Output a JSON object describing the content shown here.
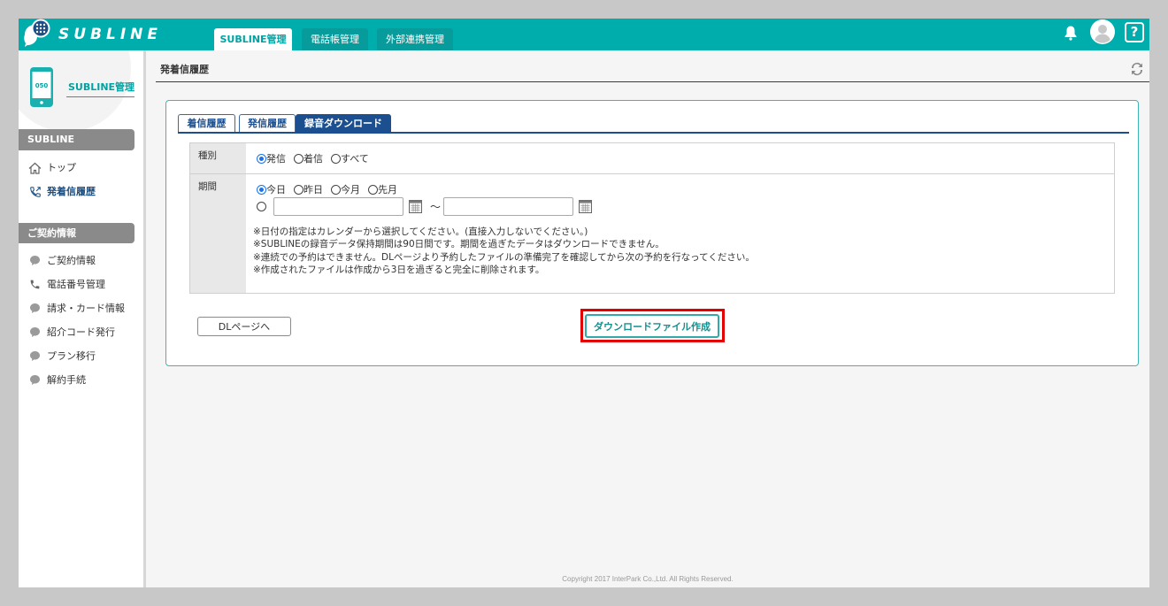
{
  "header": {
    "logo_text": "SUBLINE",
    "tabs": [
      {
        "label": "SUBLINE管理",
        "active": true
      },
      {
        "label": "電話帳管理",
        "active": false
      },
      {
        "label": "外部連携管理",
        "active": false
      }
    ],
    "help_glyph": "?",
    "icons": {
      "logo": "chat-keypad-icon",
      "notifications": "bell-icon",
      "account": "avatar-icon",
      "help": "help-icon"
    }
  },
  "sidebar": {
    "title": "SUBLINE管理",
    "device_number": "050",
    "sections": [
      {
        "header": "SUBLINE",
        "items": [
          {
            "label": "トップ",
            "icon": "home-icon",
            "active": false
          },
          {
            "label": "発着信履歴",
            "icon": "phone-calls-icon",
            "active": true
          }
        ]
      },
      {
        "header": "ご契約情報",
        "items": [
          {
            "label": "ご契約情報",
            "icon": "bubble-icon",
            "active": false
          },
          {
            "label": "電話番号管理",
            "icon": "phone-icon",
            "active": false
          },
          {
            "label": "請求・カード情報",
            "icon": "bubble-icon",
            "active": false
          },
          {
            "label": "紹介コード発行",
            "icon": "bubble-icon",
            "active": false
          },
          {
            "label": "プラン移行",
            "icon": "bubble-icon",
            "active": false
          },
          {
            "label": "解約手続",
            "icon": "bubble-icon",
            "active": false
          }
        ]
      }
    ]
  },
  "main": {
    "page_title": "発着信履歴",
    "refresh_icon": "refresh-icon",
    "tabs": [
      {
        "label": "着信履歴",
        "active": false
      },
      {
        "label": "発信履歴",
        "active": false
      },
      {
        "label": "録音ダウンロード",
        "active": true
      }
    ],
    "form": {
      "type": {
        "label": "種別",
        "options": [
          {
            "label": "発信",
            "checked": true
          },
          {
            "label": "着信",
            "checked": false
          },
          {
            "label": "すべて",
            "checked": false
          }
        ]
      },
      "period": {
        "label": "期間",
        "options": [
          {
            "label": "今日",
            "checked": true
          },
          {
            "label": "昨日",
            "checked": false
          },
          {
            "label": "今月",
            "checked": false
          },
          {
            "label": "先月",
            "checked": false
          }
        ],
        "custom_range": {
          "checked": false,
          "from": "",
          "to": "",
          "separator": "～",
          "icon": "calendar-icon"
        }
      },
      "notes": [
        "※日付の指定はカレンダーから選択してください。(直接入力しないでください。)",
        "※SUBLINEの録音データ保持期間は90日間です。期間を過ぎたデータはダウンロードできません。",
        "※連続での予約はできません。DLページより予約したファイルの準備完了を確認してから次の予約を行なってください。",
        "※作成されたファイルは作成から3日を過ぎると完全に削除されます。"
      ]
    },
    "buttons": {
      "dl_page": "DLページへ",
      "create_file": "ダウンロードファイル作成"
    },
    "footer": "Copyright 2017 InterPark Co.,Ltd. All Rights Reserved."
  },
  "colors": {
    "header": "#00adad",
    "header_tab_inactive": "#089b9b",
    "accent_teal": "#00a3a3",
    "nav_active": "#1a4d80",
    "section_header": "#8a8a8a",
    "panel_tab": "#1b4f8f",
    "highlight": "#e30000"
  }
}
